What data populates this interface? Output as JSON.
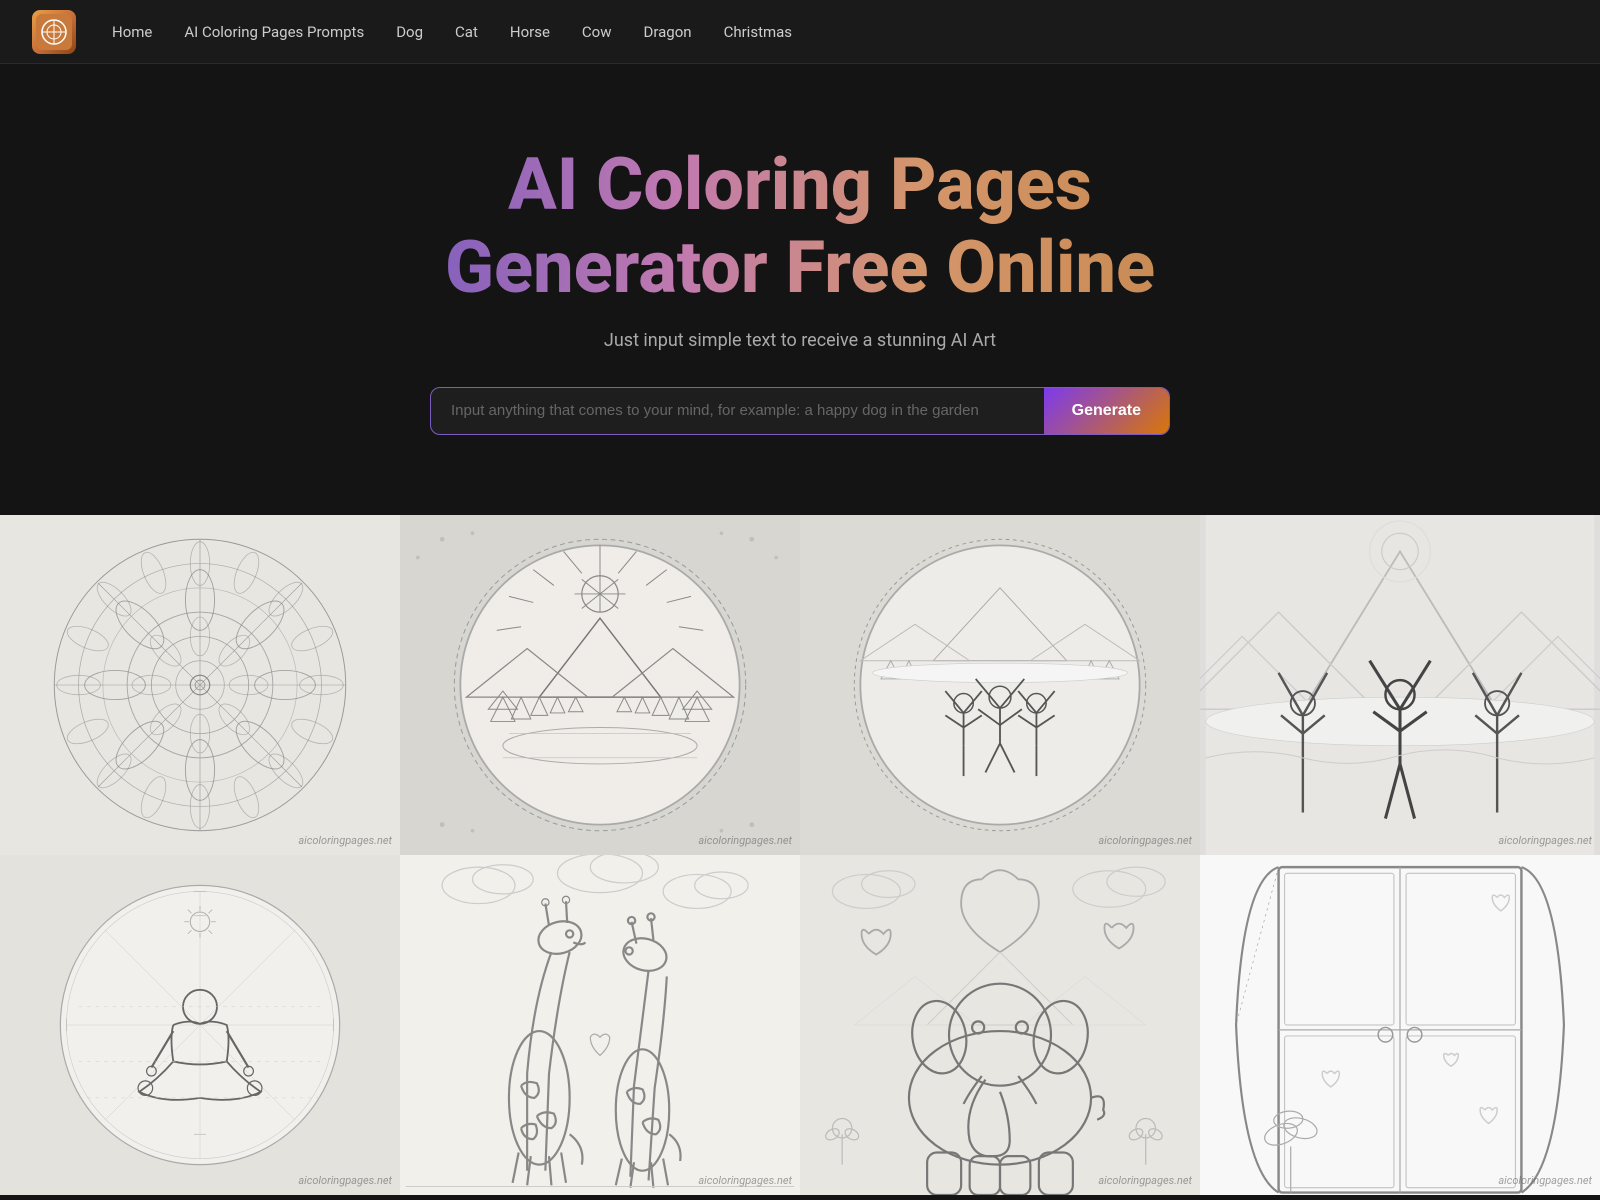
{
  "nav": {
    "logo_alt": "AI Coloring Pages Logo",
    "links": [
      {
        "label": "Home",
        "id": "home"
      },
      {
        "label": "AI Coloring Pages Prompts",
        "id": "prompts"
      },
      {
        "label": "Dog",
        "id": "dog"
      },
      {
        "label": "Cat",
        "id": "cat"
      },
      {
        "label": "Horse",
        "id": "horse"
      },
      {
        "label": "Cow",
        "id": "cow"
      },
      {
        "label": "Dragon",
        "id": "dragon"
      },
      {
        "label": "Christmas",
        "id": "christmas"
      }
    ]
  },
  "hero": {
    "title": "AI Coloring Pages Generator Free Online",
    "subtitle": "Just input simple text to receive a stunning AI Art",
    "input_placeholder": "Input anything that comes to your mind, for example: a happy dog in the garden",
    "generate_label": "Generate"
  },
  "gallery": {
    "watermark": "aicoloringpages.net",
    "items": [
      {
        "type": "mandala",
        "description": "Intricate mandala coloring page"
      },
      {
        "type": "mountain-circle",
        "description": "Mountain landscape in circle frame"
      },
      {
        "type": "yoga-circle",
        "description": "Yoga pose in circle frame with mountains"
      },
      {
        "type": "yoga-mountain",
        "description": "Three yoga poses in snowy mountain landscape"
      },
      {
        "type": "meditation",
        "description": "Meditating man in circle frame"
      },
      {
        "type": "giraffes",
        "description": "Two giraffes coloring page"
      },
      {
        "type": "elephant-heart",
        "description": "Elephant with hearts and mountains"
      },
      {
        "type": "door",
        "description": "Open window/door with plants"
      }
    ]
  }
}
